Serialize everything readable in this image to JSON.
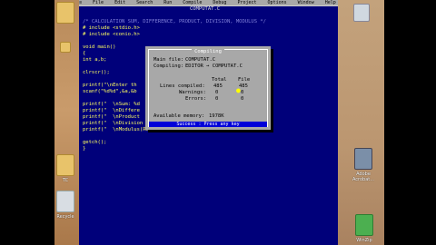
{
  "menubar": {
    "items": [
      "≡",
      "File",
      "Edit",
      "Search",
      "Run",
      "Compile",
      "Debug",
      "Project",
      "Options",
      "Window",
      "Help"
    ]
  },
  "window": {
    "title": "COMPUTAT.C"
  },
  "code": {
    "comment": "/* CALCULATION SUM, DIFFERENCE, PRODUCT, DIVISION, MODULUS */",
    "lines": [
      "# include <stdio.h>",
      "# include <conio.h>",
      "",
      "void main()",
      "{",
      "int a,b;",
      "",
      "clrscr();",
      "",
      "printf(\"\\nEnter th",
      "scanf(\"%d%d\",&a,&b",
      "",
      "printf(\"  \\nSum: %d",
      "printf(\"  \\nDiffere",
      "printf(\"  \\nProduct",
      "printf(\"  \\nDivision",
      "printf(\"  \\nModulus(Remainder): %d\",a%b);",
      "",
      "getch();",
      "}"
    ]
  },
  "dialog": {
    "title": "Compiling",
    "main_file_label": "Main file:",
    "main_file": "COMPUTAT.C",
    "compiling_label": "Compiling:",
    "compiling": "EDITOR → COMPUTAT.C",
    "col_total": "Total",
    "col_file": "File",
    "lines_label": "Lines compiled:",
    "lines_total": "485",
    "lines_file": "485",
    "warnings_label": "Warnings:",
    "warnings_total": "0",
    "warnings_file": "0",
    "errors_label": "Errors:",
    "errors_total": "0",
    "errors_file": "0",
    "memory_label": "Available memory:",
    "memory": "1978K",
    "status": "Success      :    Press any key"
  },
  "desktop": {
    "right_icons": [
      {
        "name": "printer",
        "label": "Adobe Acrobat..."
      },
      {
        "name": "zip",
        "label": "WinZip"
      }
    ],
    "left_icons": [
      {
        "name": "folder",
        "label": "TC"
      },
      {
        "name": "folder",
        "label": "CDs"
      },
      {
        "name": "trash",
        "label": "Recycle"
      }
    ]
  }
}
